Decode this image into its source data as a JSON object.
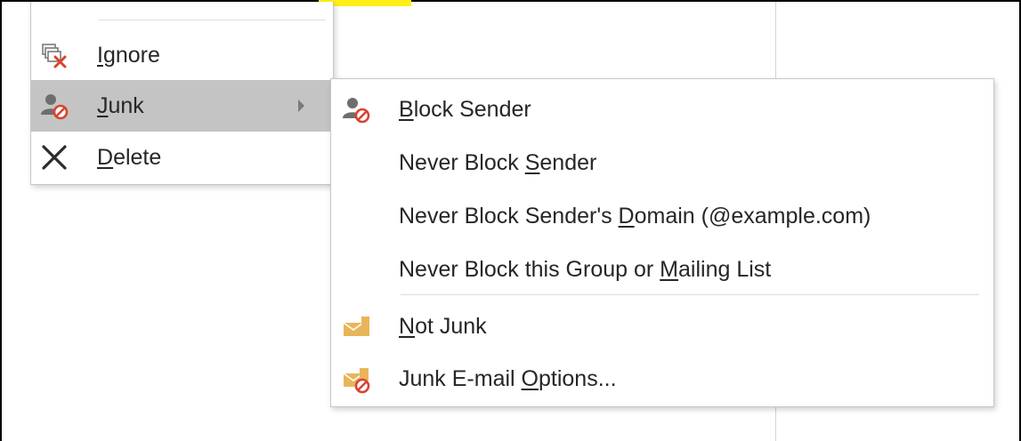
{
  "context_menu": {
    "items": [
      {
        "icon": "ignore-icon",
        "label": "Ignore",
        "mnemonic": "I"
      },
      {
        "icon": "junk-icon",
        "label": "Junk",
        "mnemonic": "J",
        "active": true,
        "has_submenu": true
      },
      {
        "icon": "delete-icon",
        "label": "Delete",
        "mnemonic": "D"
      }
    ]
  },
  "junk_submenu": {
    "items": [
      {
        "icon": "block-sender-icon",
        "label": "Block Sender",
        "mnemonic": "B"
      },
      {
        "icon": "",
        "label": "Never Block Sender",
        "mnemonic": "S"
      },
      {
        "icon": "",
        "label": "Never Block Sender's Domain (@example.com)",
        "mnemonic": "D"
      },
      {
        "icon": "",
        "label": "Never Block this Group or Mailing List",
        "mnemonic": "M"
      },
      {
        "icon": "not-junk-icon",
        "label": "Not Junk",
        "mnemonic": "N"
      },
      {
        "icon": "junk-email-options-icon",
        "label": "Junk E-mail Options...",
        "mnemonic": "O"
      }
    ]
  },
  "colors": {
    "highlight": "#ffef16",
    "active_item": "#c4c4c4",
    "block_red": "#d9432f",
    "envelope_gold": "#e9b55a",
    "person_gray": "#6e6e6e"
  }
}
